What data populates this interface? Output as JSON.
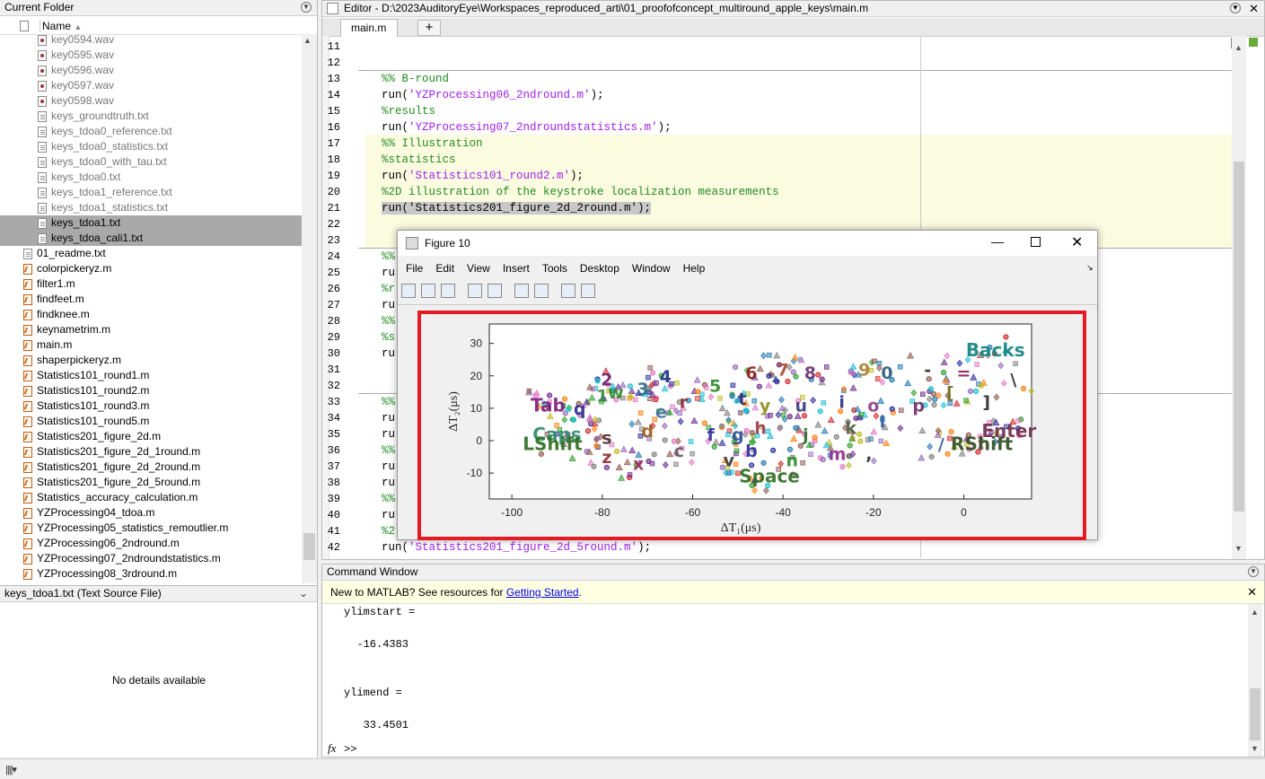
{
  "current_folder": {
    "title": "Current Folder",
    "column": "Name",
    "files": [
      {
        "name": "key0594.wav",
        "type": "w",
        "gray": true
      },
      {
        "name": "key0595.wav",
        "type": "w",
        "gray": true
      },
      {
        "name": "key0596.wav",
        "type": "w",
        "gray": true
      },
      {
        "name": "key0597.wav",
        "type": "w",
        "gray": true
      },
      {
        "name": "key0598.wav",
        "type": "w",
        "gray": true
      },
      {
        "name": "keys_groundtruth.txt",
        "type": "t",
        "gray": true
      },
      {
        "name": "keys_tdoa0_reference.txt",
        "type": "t",
        "gray": true
      },
      {
        "name": "keys_tdoa0_statistics.txt",
        "type": "t",
        "gray": true
      },
      {
        "name": "keys_tdoa0_with_tau.txt",
        "type": "t",
        "gray": true
      },
      {
        "name": "keys_tdoa0.txt",
        "type": "t",
        "gray": true
      },
      {
        "name": "keys_tdoa1_reference.txt",
        "type": "t",
        "gray": true
      },
      {
        "name": "keys_tdoa1_statistics.txt",
        "type": "t",
        "gray": true
      },
      {
        "name": "keys_tdoa1.txt",
        "type": "t",
        "gray": false,
        "selected": true
      },
      {
        "name": "keys_tdoa_cali1.txt",
        "type": "t",
        "gray": false,
        "selected": true
      },
      {
        "name": "01_readme.txt",
        "type": "t",
        "gray": false,
        "top": true
      },
      {
        "name": "colorpickeryz.m",
        "type": "m",
        "top": true
      },
      {
        "name": "filter1.m",
        "type": "m",
        "top": true
      },
      {
        "name": "findfeet.m",
        "type": "m",
        "top": true
      },
      {
        "name": "findknee.m",
        "type": "m",
        "top": true
      },
      {
        "name": "keynametrim.m",
        "type": "m",
        "top": true
      },
      {
        "name": "main.m",
        "type": "m",
        "top": true
      },
      {
        "name": "shaperpickeryz.m",
        "type": "m",
        "top": true
      },
      {
        "name": "Statistics101_round1.m",
        "type": "m",
        "top": true
      },
      {
        "name": "Statistics101_round2.m",
        "type": "m",
        "top": true
      },
      {
        "name": "Statistics101_round3.m",
        "type": "m",
        "top": true
      },
      {
        "name": "Statistics101_round5.m",
        "type": "m",
        "top": true
      },
      {
        "name": "Statistics201_figure_2d.m",
        "type": "m",
        "top": true
      },
      {
        "name": "Statistics201_figure_2d_1round.m",
        "type": "m",
        "top": true
      },
      {
        "name": "Statistics201_figure_2d_2round.m",
        "type": "m",
        "top": true
      },
      {
        "name": "Statistics201_figure_2d_5round.m",
        "type": "m",
        "top": true
      },
      {
        "name": "Statistics_accuracy_calculation.m",
        "type": "m",
        "top": true
      },
      {
        "name": "YZProcessing04_tdoa.m",
        "type": "m",
        "top": true
      },
      {
        "name": "YZProcessing05_statistics_remoutlier.m",
        "type": "m",
        "top": true
      },
      {
        "name": "YZProcessing06_2ndround.m",
        "type": "m",
        "top": true
      },
      {
        "name": "YZProcessing07_2ndroundstatistics.m",
        "type": "m",
        "top": true
      },
      {
        "name": "YZProcessing08_3rdround.m",
        "type": "m",
        "top": true
      }
    ]
  },
  "details": {
    "title": "keys_tdoa1.txt  (Text Source File)",
    "empty": "No details available"
  },
  "editor": {
    "title": "Editor - D:\\2023AuditoryEye\\Workspaces_reproduced_arti\\01_proofofconcept_multiround_apple_keys\\main.m",
    "tab": "main.m",
    "plus": "+",
    "lines": [
      {
        "n": "11",
        "parts": []
      },
      {
        "n": "12",
        "parts": []
      },
      {
        "n": "13",
        "parts": [
          {
            "c": "cmt",
            "t": "%% B-round"
          }
        ]
      },
      {
        "n": "14",
        "parts": [
          {
            "c": "",
            "t": "run("
          },
          {
            "c": "str",
            "t": "'YZProcessing06_2ndround.m'"
          },
          {
            "c": "",
            "t": ");"
          }
        ]
      },
      {
        "n": "15",
        "parts": [
          {
            "c": "cmt",
            "t": "%results"
          }
        ]
      },
      {
        "n": "16",
        "parts": [
          {
            "c": "",
            "t": "run("
          },
          {
            "c": "str",
            "t": "'YZProcessing07_2ndroundstatistics.m'"
          },
          {
            "c": "",
            "t": ");"
          }
        ]
      },
      {
        "n": "17",
        "parts": [
          {
            "c": "cmt",
            "t": "%% Illustration"
          }
        ],
        "hl": true
      },
      {
        "n": "18",
        "parts": [
          {
            "c": "cmt",
            "t": "%statistics"
          }
        ],
        "hl": true
      },
      {
        "n": "19",
        "parts": [
          {
            "c": "",
            "t": "run("
          },
          {
            "c": "str",
            "t": "'Statistics101_round2.m'"
          },
          {
            "c": "",
            "t": ");"
          }
        ],
        "hl": true
      },
      {
        "n": "20",
        "parts": [
          {
            "c": "cmt",
            "t": "%2D illustration of the keystroke localization measurements"
          }
        ],
        "hl": true
      },
      {
        "n": "21",
        "parts": [
          {
            "c": "sel",
            "t": "run('Statistics201_figure_2d_2round.m');"
          }
        ],
        "hl": true
      },
      {
        "n": "22",
        "parts": [],
        "hl": true
      },
      {
        "n": "23",
        "parts": [],
        "hl": true
      },
      {
        "n": "24",
        "parts": [
          {
            "c": "cmt",
            "t": "%%"
          }
        ]
      },
      {
        "n": "25",
        "parts": [
          {
            "c": "",
            "t": "ru"
          }
        ]
      },
      {
        "n": "26",
        "parts": [
          {
            "c": "cmt",
            "t": "%r"
          }
        ]
      },
      {
        "n": "27",
        "parts": [
          {
            "c": "",
            "t": "ru"
          }
        ]
      },
      {
        "n": "28",
        "parts": [
          {
            "c": "cmt",
            "t": "%%"
          }
        ]
      },
      {
        "n": "29",
        "parts": [
          {
            "c": "cmt",
            "t": "%s"
          }
        ]
      },
      {
        "n": "30",
        "parts": [
          {
            "c": "",
            "t": "ru"
          }
        ]
      },
      {
        "n": "31",
        "parts": []
      },
      {
        "n": "32",
        "parts": []
      },
      {
        "n": "33",
        "parts": [
          {
            "c": "cmt",
            "t": "%%"
          }
        ]
      },
      {
        "n": "34",
        "parts": [
          {
            "c": "",
            "t": "ru"
          }
        ]
      },
      {
        "n": "35",
        "parts": [
          {
            "c": "",
            "t": "ru"
          }
        ]
      },
      {
        "n": "36",
        "parts": [
          {
            "c": "cmt",
            "t": "%%"
          }
        ]
      },
      {
        "n": "37",
        "parts": [
          {
            "c": "",
            "t": "ru"
          }
        ]
      },
      {
        "n": "38",
        "parts": [
          {
            "c": "",
            "t": "ru"
          }
        ]
      },
      {
        "n": "39",
        "parts": [
          {
            "c": "cmt",
            "t": "%%"
          }
        ]
      },
      {
        "n": "40",
        "parts": [
          {
            "c": "",
            "t": "ru"
          }
        ]
      },
      {
        "n": "41",
        "parts": [
          {
            "c": "cmt",
            "t": "%2"
          }
        ]
      },
      {
        "n": "42",
        "parts": [
          {
            "c": "",
            "t": "run("
          },
          {
            "c": "str",
            "t": "'Statistics201_figure_2d_5round.m'"
          },
          {
            "c": "",
            "t": ");"
          }
        ]
      }
    ]
  },
  "figure": {
    "title": "Figure 10",
    "menus": [
      "File",
      "Edit",
      "View",
      "Insert",
      "Tools",
      "Desktop",
      "Window",
      "Help"
    ],
    "tools": [
      "new-icon",
      "open-icon",
      "save-icon",
      "print-icon",
      "link-icon",
      "colorbar-icon",
      "legend-icon",
      "pointer-icon",
      "propertyeditor-icon"
    ]
  },
  "chart_data": {
    "type": "scatter",
    "xlabel": "ΔT₁(μs)",
    "ylabel": "ΔT₂(μs)",
    "xlim": [
      -105,
      15
    ],
    "ylim": [
      -18,
      36
    ],
    "xticks": [
      "-100",
      "-80",
      "-60",
      "-40",
      "-20",
      "0"
    ],
    "yticks": [
      "30",
      "20",
      "10",
      "0",
      "-10"
    ],
    "labels": [
      {
        "t": "Backs",
        "x": 7,
        "y": 28,
        "c": "#0f7f7f"
      },
      {
        "t": "Tab",
        "x": -92,
        "y": 11,
        "c": "#7a1a7a"
      },
      {
        "t": "Caps",
        "x": -90,
        "y": 2,
        "c": "#2a8a6a"
      },
      {
        "t": "LShift",
        "x": -91,
        "y": -1,
        "c": "#2e6b1e"
      },
      {
        "t": "Space",
        "x": -43,
        "y": -11,
        "c": "#2e6b1e"
      },
      {
        "t": "RShift",
        "x": 4,
        "y": -1,
        "c": "#2e4a1e"
      },
      {
        "t": "Enter",
        "x": 10,
        "y": 3,
        "c": "#6b2a4a"
      },
      {
        "t": "q",
        "x": -85,
        "y": 10,
        "c": "#2a2a8a"
      },
      {
        "t": "w",
        "x": -77,
        "y": 15,
        "c": "#2a8a2a"
      },
      {
        "t": "2",
        "x": -79,
        "y": 19,
        "c": "#6a1a6a"
      },
      {
        "t": "1",
        "x": -80,
        "y": 14,
        "c": "#3a8a3a"
      },
      {
        "t": "3",
        "x": -71,
        "y": 16,
        "c": "#2a6a8a"
      },
      {
        "t": "4",
        "x": -66,
        "y": 20,
        "c": "#1a2a8a"
      },
      {
        "t": "e",
        "x": -67,
        "y": 9,
        "c": "#3a6a9a"
      },
      {
        "t": "r",
        "x": -62,
        "y": 12,
        "c": "#8a2a2a"
      },
      {
        "t": "5",
        "x": -55,
        "y": 17,
        "c": "#2a8a2a"
      },
      {
        "t": "6",
        "x": -47,
        "y": 21,
        "c": "#8a1a1a"
      },
      {
        "t": "7",
        "x": -40,
        "y": 22,
        "c": "#aa4a2a"
      },
      {
        "t": "8",
        "x": -34,
        "y": 21,
        "c": "#6a2a6a"
      },
      {
        "t": "9",
        "x": -22,
        "y": 22,
        "c": "#aa7a2a"
      },
      {
        "t": "0",
        "x": -17,
        "y": 21,
        "c": "#2a5a7a"
      },
      {
        "t": "-",
        "x": -8,
        "y": 22,
        "c": "#2a2a2a"
      },
      {
        "t": "=",
        "x": 0,
        "y": 21,
        "c": "#8a1a5a"
      },
      {
        "t": "t",
        "x": -49,
        "y": 13,
        "c": "#2a2a6a"
      },
      {
        "t": "y",
        "x": -44,
        "y": 11,
        "c": "#8a8a1a"
      },
      {
        "t": "u",
        "x": -36,
        "y": 11,
        "c": "#3a3a7a"
      },
      {
        "t": "i",
        "x": -27,
        "y": 12,
        "c": "#2a2a8a"
      },
      {
        "t": "o",
        "x": -20,
        "y": 11,
        "c": "#8a3a7a"
      },
      {
        "t": "p",
        "x": -10,
        "y": 11,
        "c": "#6a2a6a"
      },
      {
        "t": "[",
        "x": -3,
        "y": 15,
        "c": "#6a6a1a"
      },
      {
        "t": "]",
        "x": 5,
        "y": 12,
        "c": "#2a2a2a"
      },
      {
        "t": "\\",
        "x": 11,
        "y": 19,
        "c": "#2a2a2a"
      },
      {
        "t": "s",
        "x": -79,
        "y": 1,
        "c": "#4a2a2a"
      },
      {
        "t": "d",
        "x": -70,
        "y": 3,
        "c": "#9a5a1a"
      },
      {
        "t": "f",
        "x": -56,
        "y": 2,
        "c": "#2a2a9a"
      },
      {
        "t": "g",
        "x": -50,
        "y": 2,
        "c": "#2a4a9a"
      },
      {
        "t": "h",
        "x": -45,
        "y": 4,
        "c": "#9a3a5a"
      },
      {
        "t": "j",
        "x": -35,
        "y": 2,
        "c": "#2a6a2a"
      },
      {
        "t": "k",
        "x": -25,
        "y": 4,
        "c": "#4a5a3a"
      },
      {
        "t": "l",
        "x": -18,
        "y": 6,
        "c": "#2a5a9a"
      },
      {
        "t": "z",
        "x": -79,
        "y": -5,
        "c": "#8a2a2a"
      },
      {
        "t": "x",
        "x": -72,
        "y": -7,
        "c": "#9a2a5a"
      },
      {
        "t": "c",
        "x": -63,
        "y": -3,
        "c": "#5a5a5a"
      },
      {
        "t": "v",
        "x": -52,
        "y": -6,
        "c": "#3a3a3a"
      },
      {
        "t": "b",
        "x": -47,
        "y": -3,
        "c": "#2a2a9a"
      },
      {
        "t": "n",
        "x": -38,
        "y": -6,
        "c": "#2a8a2a"
      },
      {
        "t": "m",
        "x": -28,
        "y": -4,
        "c": "#8a2a8a"
      },
      {
        "t": ",",
        "x": -21,
        "y": -4,
        "c": "#2a2a2a"
      },
      {
        "t": "/",
        "x": -5,
        "y": -1,
        "c": "#2a5a9a"
      }
    ]
  },
  "command": {
    "title": "Command Window",
    "banner": "New to MATLAB? See resources for ",
    "banner_link": "Getting Started",
    "banner_end": ".",
    "lines": [
      "ylimstart =",
      "",
      "  -16.4383",
      "",
      "",
      "ylimend =",
      "",
      "   33.4501"
    ],
    "prompt": ">>",
    "fx": "fx"
  }
}
